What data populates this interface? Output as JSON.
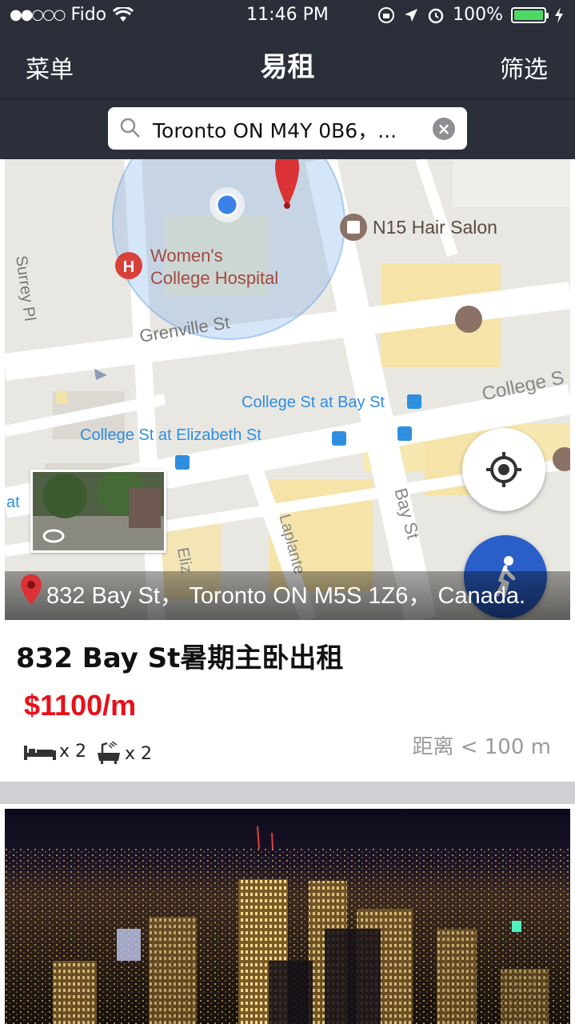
{
  "status_bar": {
    "carrier": "Fido",
    "time": "11:46 PM",
    "battery": "100%",
    "battery_level": 1.0
  },
  "nav": {
    "menu_label": "菜单",
    "title": "易租",
    "filter_label": "筛选"
  },
  "search": {
    "value": "Toronto ON M4Y 0B6，..."
  },
  "map": {
    "labels": {
      "hair_salon": "N15 Hair Salon",
      "hospital_line1": "Women's",
      "hospital_line2": "College Hospital",
      "grenville": "Grenville St",
      "surrey": "Surrey Pl",
      "college_bay": "College St at Bay St",
      "college_elizabeth": "College St at Elizabeth St",
      "college_st": "College S",
      "bay_st": "Bay St",
      "laplante": "Laplante",
      "eliz": "Eliz",
      "at": "at"
    },
    "address": "832 Bay St， Toronto ON M5S 1Z6， Canada."
  },
  "listing": {
    "title": "832 Bay St暑期主卧出租",
    "price": "$1100/m",
    "bedrooms": "x 2",
    "bathrooms": "x 2",
    "distance": "距离 < 100 m"
  },
  "colors": {
    "nav_bg": "#2b2f3a",
    "price": "#e8101a",
    "map_pin": "#db3236",
    "walk_button": "#2a5ec8"
  }
}
